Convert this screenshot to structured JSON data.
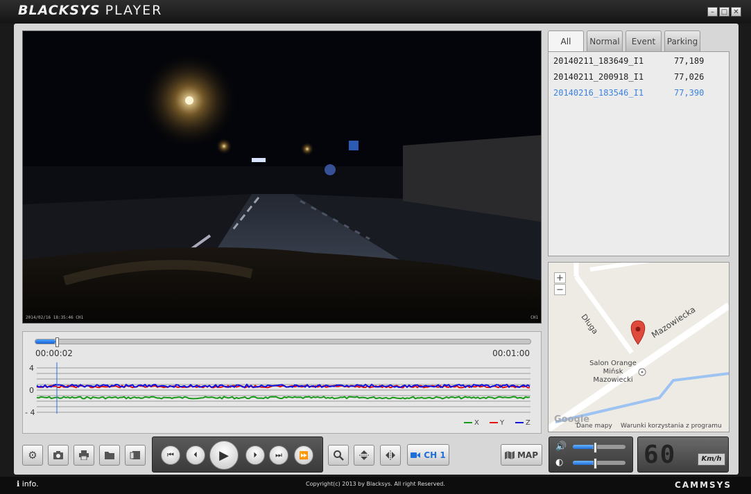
{
  "app": {
    "brand_bold": "BLACKSYS",
    "brand_light": "PLAYER"
  },
  "window": {
    "minimize": "–",
    "restore": "□",
    "close": "✕"
  },
  "video": {
    "overlay_left": "2014/02/16 18:35:46 CH1",
    "overlay_right": "CH1"
  },
  "timeline": {
    "current": "00:00:02",
    "total": "00:01:00",
    "progress": 0.04
  },
  "gsensor": {
    "ticks": [
      "4",
      "0",
      "- 4"
    ],
    "legend": [
      {
        "label": "X",
        "color": "#1a9a1a"
      },
      {
        "label": "Y",
        "color": "#e01010"
      },
      {
        "label": "Z",
        "color": "#1010e0"
      }
    ]
  },
  "tabs": [
    "All",
    "Normal",
    "Event",
    "Parking"
  ],
  "files": [
    {
      "name": "20140211_183649_I1",
      "size": "77,189"
    },
    {
      "name": "20140211_200918_I1",
      "size": "77,026"
    },
    {
      "name": "20140216_183546_I1",
      "size": "77,390"
    }
  ],
  "map": {
    "zoom_in": "+",
    "zoom_out": "−",
    "streets": {
      "dluga": "Długa",
      "mazowiecka": "Mazowiecka"
    },
    "poi": [
      "Salon Orange",
      "Mińsk",
      "Mazowiecki"
    ],
    "google": "Google",
    "footer_left": "Dane mapy",
    "footer_right": "Warunki korzystania z programu"
  },
  "toolbar": {
    "channel": "CH 1",
    "map": "MAP"
  },
  "icons": [
    "settings-icon",
    "camera-icon",
    "print-icon",
    "folder-icon",
    "export-icon",
    "skip-back-icon",
    "frame-back-icon",
    "play-icon",
    "frame-forward-icon",
    "skip-forward-icon",
    "fast-forward-icon",
    "zoom-icon",
    "flip-vertical-icon",
    "flip-horizontal-icon",
    "volume-icon",
    "brightness-icon"
  ],
  "mixer": {
    "volume": 0.4,
    "brightness": 0.4
  },
  "speed": {
    "value": "60",
    "unit": "Km/h"
  },
  "status": {
    "info": "info.",
    "copyright": "Copyright(c) 2013 by Blacksys. All right Reserved.",
    "company": "CAMMSYS"
  },
  "colors": {
    "accent": "#1f6fd8",
    "selected_file": "#3b82e0",
    "frame": "#d7d7d7"
  }
}
